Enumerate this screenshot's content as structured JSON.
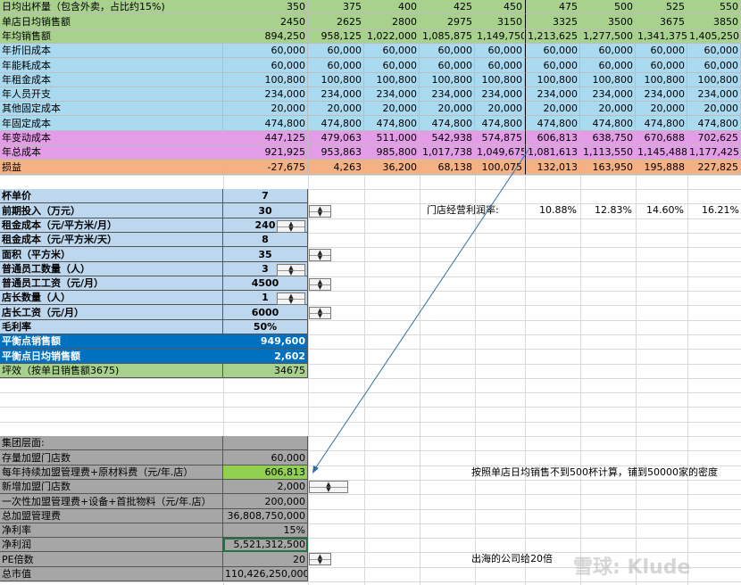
{
  "colors": {
    "green": "#a9d18e",
    "blue": "#9dc3e6",
    "skyblue": "#a9daf0",
    "pink": "#e39ce6",
    "orange": "#f4b183",
    "lightblue": "#bdd7ee",
    "darkblue": "#0070c0",
    "greenlight": "#a9d18e",
    "gray": "#a6a6a6",
    "highlight": "#92d050"
  },
  "top_table": {
    "columns": [
      "350",
      "375",
      "400",
      "425",
      "450",
      "475",
      "500",
      "525",
      "550"
    ],
    "rows": [
      {
        "label": "日均出杯量（包含外卖，占比约15%)",
        "values": [
          "350",
          "375",
          "400",
          "425",
          "450",
          "475",
          "500",
          "525",
          "550"
        ],
        "color": "green"
      },
      {
        "label": "单店日均销售额",
        "values": [
          "2450",
          "2625",
          "2800",
          "2975",
          "3150",
          "3325",
          "3500",
          "3675",
          "3850"
        ],
        "color": "green"
      },
      {
        "label": "年均销售额",
        "values": [
          "894,250",
          "958,125",
          "1,022,000",
          "1,085,875",
          "1,149,750",
          "1,213,625",
          "1,277,500",
          "1,341,375",
          "1,405,250"
        ],
        "color": "green"
      },
      {
        "label": "年折旧成本",
        "values": [
          "60,000",
          "60,000",
          "60,000",
          "60,000",
          "60,000",
          "60,000",
          "60,000",
          "60,000",
          "60,000"
        ],
        "color": "skyblue"
      },
      {
        "label": "年能耗成本",
        "values": [
          "60,000",
          "60,000",
          "60,000",
          "60,000",
          "60,000",
          "60,000",
          "60,000",
          "60,000",
          "60,000"
        ],
        "color": "skyblue"
      },
      {
        "label": "年租金成本",
        "values": [
          "100,800",
          "100,800",
          "100,800",
          "100,800",
          "100,800",
          "100,800",
          "100,800",
          "100,800",
          "100,800"
        ],
        "color": "skyblue"
      },
      {
        "label": "年人员开支",
        "values": [
          "234,000",
          "234,000",
          "234,000",
          "234,000",
          "234,000",
          "234,000",
          "234,000",
          "234,000",
          "234,000"
        ],
        "color": "skyblue"
      },
      {
        "label": "其他固定成本",
        "values": [
          "20,000",
          "20,000",
          "20,000",
          "20,000",
          "20,000",
          "20,000",
          "20,000",
          "20,000",
          "20,000"
        ],
        "color": "skyblue"
      },
      {
        "label": "年固定成本",
        "values": [
          "474,800",
          "474,800",
          "474,800",
          "474,800",
          "474,800",
          "474,800",
          "474,800",
          "474,800",
          "474,800"
        ],
        "color": "skyblue"
      },
      {
        "label": "年变动成本",
        "values": [
          "447,125",
          "479,063",
          "511,000",
          "542,938",
          "574,875",
          "606,813",
          "638,750",
          "670,688",
          "702,625"
        ],
        "color": "pink"
      },
      {
        "label": "年总成本",
        "values": [
          "921,925",
          "953,863",
          "985,800",
          "1,017,738",
          "1,049,675",
          "1,081,613",
          "1,113,550",
          "1,145,488",
          "1,177,425"
        ],
        "color": "pink"
      },
      {
        "label": "损益",
        "values": [
          "-27,675",
          "4,263",
          "36,200",
          "68,138",
          "100,075",
          "132,013",
          "163,950",
          "195,888",
          "227,825"
        ],
        "color": "orange"
      }
    ]
  },
  "params": [
    {
      "label": "杯单价",
      "value": "7",
      "color": "lightblue",
      "spinner": false
    },
    {
      "label": "前期投入（万元）",
      "value": "30",
      "color": "lightblue",
      "spinner": true
    },
    {
      "label": "租金成本（元/平方米/月）",
      "value": "240",
      "color": "lightblue",
      "spinner": true
    },
    {
      "label": "租金成本（元/平方米/天）",
      "value": "8",
      "color": "lightblue",
      "spinner": false
    },
    {
      "label": "面积（平方米）",
      "value": "35",
      "color": "lightblue",
      "spinner": true
    },
    {
      "label": "普通员工数量（人）",
      "value": "3",
      "color": "lightblue",
      "spinner": true
    },
    {
      "label": "普通员工工资（元/月）",
      "value": "4500",
      "color": "lightblue",
      "spinner": true
    },
    {
      "label": "店长数量（人）",
      "value": "1",
      "color": "lightblue",
      "spinner": true
    },
    {
      "label": "店长工资（元/月）",
      "value": "6000",
      "color": "lightblue",
      "spinner": true
    },
    {
      "label": "毛利率",
      "value": "50%",
      "color": "lightblue",
      "spinner": false
    },
    {
      "label": "平衡点销售额",
      "value": "949,600",
      "color": "darkblue",
      "spinner": false
    },
    {
      "label": "平衡点日均销售额",
      "value": "2,602",
      "color": "darkblue",
      "spinner": false
    },
    {
      "label": "坪效（按单日销售额3675)",
      "value": "34675",
      "color": "greenlight",
      "spinner": false
    }
  ],
  "margin": {
    "label": "门店经营利润率:",
    "values": [
      "10.88%",
      "12.83%",
      "14.60%",
      "16.21%"
    ]
  },
  "group": {
    "header": "集团层面:",
    "rows": [
      {
        "label": "存量加盟门店数",
        "value": "60,000",
        "spinner": false,
        "highlight": false
      },
      {
        "label": "每年持续加盟管理费+原材料费（元/年.店）",
        "value": "606,813",
        "spinner": false,
        "highlight": true
      },
      {
        "label": "新增加盟门店数",
        "value": "2,000",
        "spinner": true,
        "highlight": false
      },
      {
        "label": "一次性加盟管理费+设备+首批物料（元/年.店）",
        "value": "200,000",
        "spinner": false,
        "highlight": false
      },
      {
        "label": "总加盟管理费",
        "value": "36,808,750,000",
        "spinner": false,
        "highlight": false
      },
      {
        "label": "净利率",
        "value": "15%",
        "spinner": false,
        "highlight": false
      },
      {
        "label": "净利润",
        "value": "5,521,312,500",
        "spinner": false,
        "highlight": false,
        "selected": true
      },
      {
        "label": "PE倍数",
        "value": "20",
        "spinner": true,
        "highlight": false
      },
      {
        "label": "总市值",
        "value": "110,426,250,000",
        "spinner": false,
        "highlight": false
      }
    ]
  },
  "notes": {
    "density": "按照单店日均销售不到500杯计算，铺到50000家的密度",
    "overseas": "出海的公司给20倍"
  },
  "watermark": "雪球: Klude"
}
